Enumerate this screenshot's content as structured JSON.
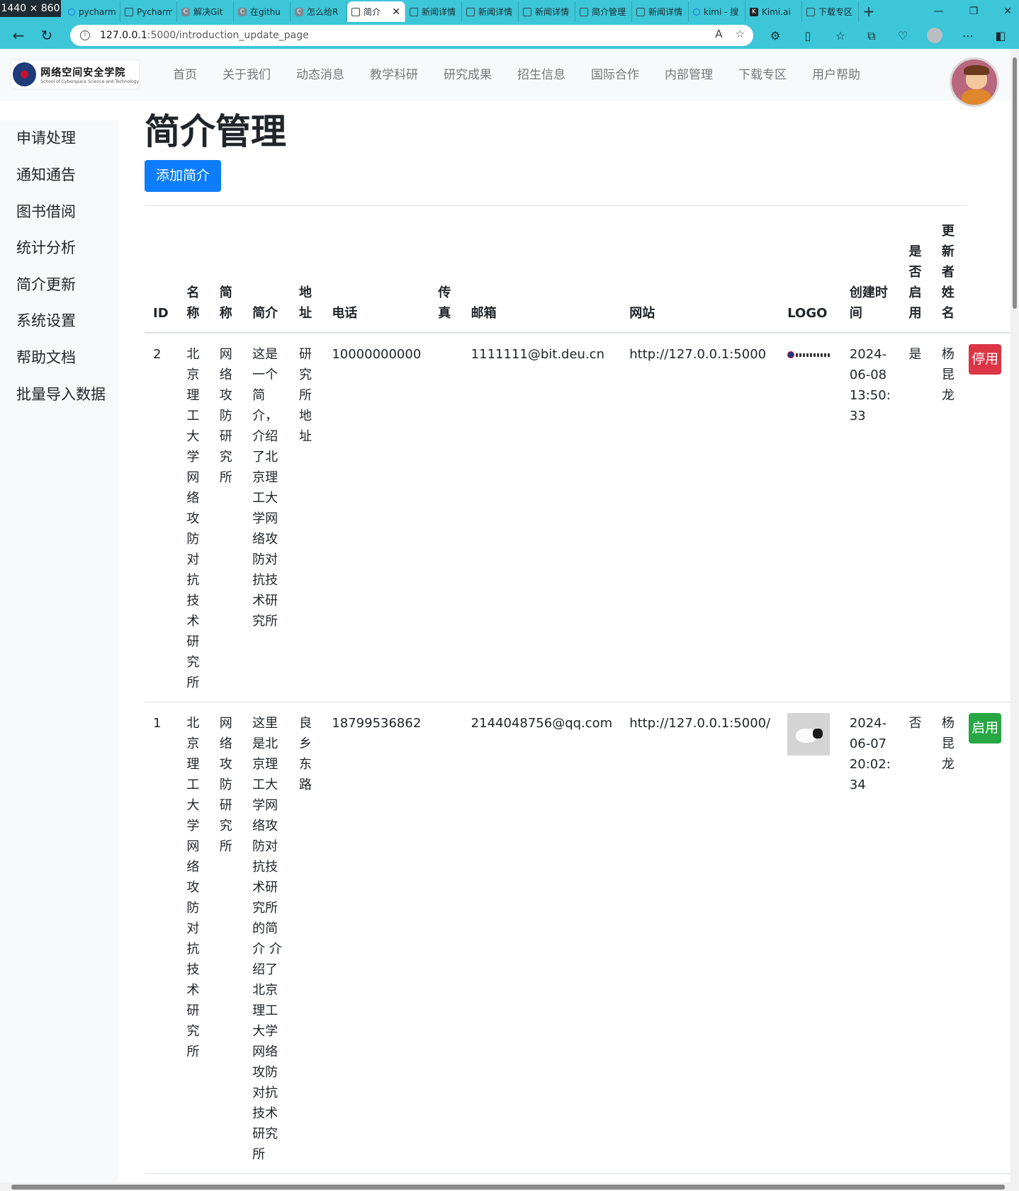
{
  "browser": {
    "dim_badge": "1440 × 860",
    "tabs": [
      {
        "label": "pycharm",
        "icon": "search"
      },
      {
        "label": "Pycharm",
        "icon": "github"
      },
      {
        "label": "解决Git",
        "icon": "c"
      },
      {
        "label": "在githu",
        "icon": "c"
      },
      {
        "label": "怎么给R",
        "icon": "c"
      },
      {
        "label": "简介",
        "icon": "page",
        "active": true
      },
      {
        "label": "新闻详情",
        "icon": "page"
      },
      {
        "label": "新闻详情",
        "icon": "page"
      },
      {
        "label": "新闻详情",
        "icon": "page"
      },
      {
        "label": "简介管理",
        "icon": "page"
      },
      {
        "label": "新闻详情",
        "icon": "page"
      },
      {
        "label": "kimi - 搜",
        "icon": "search"
      },
      {
        "label": "Kimi.ai",
        "icon": "k"
      },
      {
        "label": "下载专区",
        "icon": "page"
      }
    ],
    "url_host": "127.0.0.1",
    "url_path": ":5000/introduction_update_page",
    "chrome_color": "#3cc6d8"
  },
  "site": {
    "logo_cn": "网络空间安全学院",
    "logo_en": "School of Cyberspace Science and Technology",
    "menu": [
      "首页",
      "关于我们",
      "动态消息",
      "教学科研",
      "研究成果",
      "招生信息",
      "国际合作",
      "内部管理",
      "下载专区",
      "用户帮助"
    ]
  },
  "sidebar": {
    "items": [
      "申请处理",
      "通知通告",
      "图书借阅",
      "统计分析",
      "简介更新",
      "系统设置",
      "帮助文档",
      "批量导入数据"
    ]
  },
  "main": {
    "title": "简介管理",
    "add_button": "添加简介",
    "headers": [
      "ID",
      "名称",
      "简称",
      "简介",
      "地址",
      "电话",
      "传真",
      "邮箱",
      "网站",
      "LOGO",
      "创建时间",
      "是否启用",
      "更新者姓名"
    ],
    "rows": [
      {
        "id": "2",
        "name": "北京理工大学网络攻防对抗技术研究所",
        "short": "网络攻防研究所",
        "intro": "这是一个简介，介绍了北京理工大学网络攻防对抗技术研究所",
        "address": "研究所地址",
        "phone": "10000000000",
        "fax": "",
        "email": "1111111@bit.deu.cn",
        "website": "http://127.0.0.1:5000",
        "created": "2024-06-08 13:50:33",
        "enabled": "是",
        "updater": "杨昆龙",
        "action": "停用",
        "action_color": "#dc3545"
      },
      {
        "id": "1",
        "name": "北京理工大学网络攻防对抗技术研究所",
        "short": "网络攻防研究所",
        "intro": "这里是北京理工大学网络攻防对抗技术研究所的简介 介绍了北京理工大学网络攻防对抗技术研究所",
        "address": "良乡东路",
        "phone": "18799536862",
        "fax": "",
        "email": "2144048756@qq.com",
        "website": "http://127.0.0.1:5000/",
        "created": "2024-06-07 20:02:34",
        "enabled": "否",
        "updater": "杨昆龙",
        "action": "启用",
        "action_color": "#28a745"
      }
    ]
  }
}
